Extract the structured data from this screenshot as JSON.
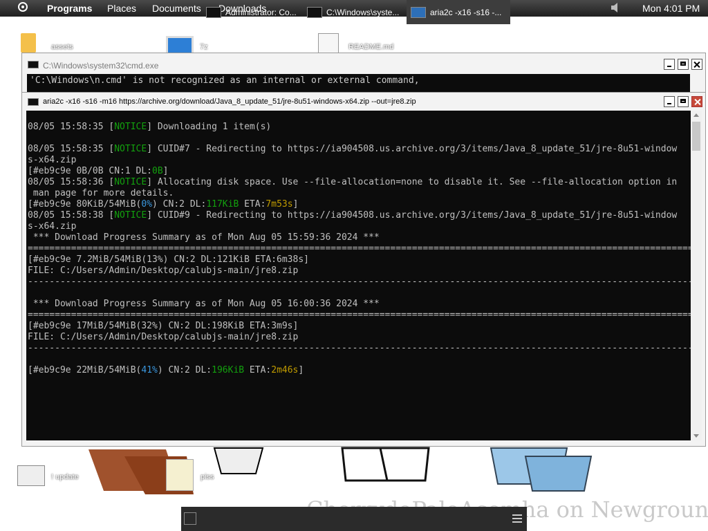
{
  "topbar": {
    "programs": "Programs",
    "places": "Places",
    "documents": "Documents",
    "downloads": "Downloads",
    "clock": "Mon 4:01 PM"
  },
  "desktop": {
    "icon_assets": "assets",
    "icon_7z": "7z",
    "icon_readme": "README.md",
    "icon_update": "! update",
    "icon_piss": "piss",
    "watermark": "CherrydoPaloAcomha on Newgrounds."
  },
  "cmd_window": {
    "title": "C:\\Windows\\system32\\cmd.exe",
    "line1": "'C:\\Windows\\n.cmd' is not recognized as an internal or external command,"
  },
  "aria_window": {
    "title": "aria2c  -x16 -s16 -m16 https://archive.org/download/Java_8_update_51/jre-8u51-windows-x64.zip --out=jre8.zip",
    "lines": {
      "l1_time": "08/05 15:58:35 [",
      "l1_tag": "NOTICE",
      "l1_rest": "] Downloading 1 item(s)",
      "l2_time": "08/05 15:58:35 [",
      "l2_tag": "NOTICE",
      "l2_rest": "] CUID#7 - Redirecting to https://ia904508.us.archive.org/3/items/Java_8_update_51/jre-8u51-window",
      "l3": "s-x64.zip",
      "l4_a": "[#eb9c9e 0B/0B CN:1 DL:",
      "l4_dl": "0B",
      "l4_b": "]",
      "l5_time": "08/05 15:58:36 [",
      "l5_tag": "NOTICE",
      "l5_rest": "] Allocating disk space. Use --file-allocation=none to disable it. See --file-allocation option in",
      "l6": " man page for more details.",
      "l7_a": "[#eb9c9e 80KiB/54MiB(",
      "l7_pct": "0%",
      "l7_b": ") CN:2 DL:",
      "l7_dl": "117KiB",
      "l7_c": " ETA:",
      "l7_eta": "7m53s",
      "l7_d": "]",
      "l8_time": "08/05 15:58:38 [",
      "l8_tag": "NOTICE",
      "l8_rest": "] CUID#9 - Redirecting to https://ia904508.us.archive.org/3/items/Java_8_update_51/jre-8u51-window",
      "l9": "s-x64.zip",
      "l10": " *** Download Progress Summary as of Mon Aug 05 15:59:36 2024 ***",
      "sep_eq": "===============================================================================================================================",
      "l12": "[#eb9c9e 7.2MiB/54MiB(13%) CN:2 DL:121KiB ETA:6m38s]",
      "l13": "FILE: C:/Users/Admin/Desktop/calubjs-main/jre8.zip",
      "sep_dash": "-------------------------------------------------------------------------------------------------------------------------------",
      "l16": " *** Download Progress Summary as of Mon Aug 05 16:00:36 2024 ***",
      "l18": "[#eb9c9e 17MiB/54MiB(32%) CN:2 DL:198KiB ETA:3m9s]",
      "l19": "FILE: C:/Users/Admin/Desktop/calubjs-main/jre8.zip",
      "l22_a": "[#eb9c9e 22MiB/54MiB(",
      "l22_pct": "41%",
      "l22_b": ") CN:2 DL:",
      "l22_dl": "196KiB",
      "l22_c": " ETA:",
      "l22_eta": "2m46s",
      "l22_d": "]"
    }
  },
  "taskbar": {
    "item1": "Administrator: Co...",
    "item2": "C:\\Windows\\syste...",
    "item3": "aria2c  -x16 -s16 -..."
  },
  "colors": {
    "notice": "#13a10e",
    "percent": "#3a96dd",
    "eta": "#c19c00",
    "terminal_bg": "#0c0c0c"
  }
}
